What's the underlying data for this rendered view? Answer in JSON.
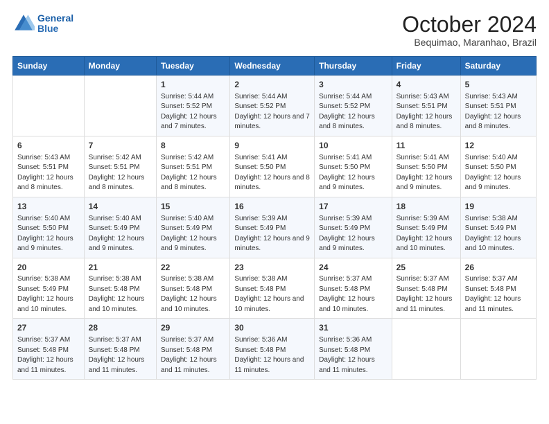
{
  "logo": {
    "line1": "General",
    "line2": "Blue"
  },
  "title": "October 2024",
  "subtitle": "Bequimao, Maranhao, Brazil",
  "weekdays": [
    "Sunday",
    "Monday",
    "Tuesday",
    "Wednesday",
    "Thursday",
    "Friday",
    "Saturday"
  ],
  "weeks": [
    [
      {
        "day": "",
        "info": ""
      },
      {
        "day": "",
        "info": ""
      },
      {
        "day": "1",
        "info": "Sunrise: 5:44 AM\nSunset: 5:52 PM\nDaylight: 12 hours and 7 minutes."
      },
      {
        "day": "2",
        "info": "Sunrise: 5:44 AM\nSunset: 5:52 PM\nDaylight: 12 hours and 7 minutes."
      },
      {
        "day": "3",
        "info": "Sunrise: 5:44 AM\nSunset: 5:52 PM\nDaylight: 12 hours and 8 minutes."
      },
      {
        "day": "4",
        "info": "Sunrise: 5:43 AM\nSunset: 5:51 PM\nDaylight: 12 hours and 8 minutes."
      },
      {
        "day": "5",
        "info": "Sunrise: 5:43 AM\nSunset: 5:51 PM\nDaylight: 12 hours and 8 minutes."
      }
    ],
    [
      {
        "day": "6",
        "info": "Sunrise: 5:43 AM\nSunset: 5:51 PM\nDaylight: 12 hours and 8 minutes."
      },
      {
        "day": "7",
        "info": "Sunrise: 5:42 AM\nSunset: 5:51 PM\nDaylight: 12 hours and 8 minutes."
      },
      {
        "day": "8",
        "info": "Sunrise: 5:42 AM\nSunset: 5:51 PM\nDaylight: 12 hours and 8 minutes."
      },
      {
        "day": "9",
        "info": "Sunrise: 5:41 AM\nSunset: 5:50 PM\nDaylight: 12 hours and 8 minutes."
      },
      {
        "day": "10",
        "info": "Sunrise: 5:41 AM\nSunset: 5:50 PM\nDaylight: 12 hours and 9 minutes."
      },
      {
        "day": "11",
        "info": "Sunrise: 5:41 AM\nSunset: 5:50 PM\nDaylight: 12 hours and 9 minutes."
      },
      {
        "day": "12",
        "info": "Sunrise: 5:40 AM\nSunset: 5:50 PM\nDaylight: 12 hours and 9 minutes."
      }
    ],
    [
      {
        "day": "13",
        "info": "Sunrise: 5:40 AM\nSunset: 5:50 PM\nDaylight: 12 hours and 9 minutes."
      },
      {
        "day": "14",
        "info": "Sunrise: 5:40 AM\nSunset: 5:49 PM\nDaylight: 12 hours and 9 minutes."
      },
      {
        "day": "15",
        "info": "Sunrise: 5:40 AM\nSunset: 5:49 PM\nDaylight: 12 hours and 9 minutes."
      },
      {
        "day": "16",
        "info": "Sunrise: 5:39 AM\nSunset: 5:49 PM\nDaylight: 12 hours and 9 minutes."
      },
      {
        "day": "17",
        "info": "Sunrise: 5:39 AM\nSunset: 5:49 PM\nDaylight: 12 hours and 9 minutes."
      },
      {
        "day": "18",
        "info": "Sunrise: 5:39 AM\nSunset: 5:49 PM\nDaylight: 12 hours and 10 minutes."
      },
      {
        "day": "19",
        "info": "Sunrise: 5:38 AM\nSunset: 5:49 PM\nDaylight: 12 hours and 10 minutes."
      }
    ],
    [
      {
        "day": "20",
        "info": "Sunrise: 5:38 AM\nSunset: 5:49 PM\nDaylight: 12 hours and 10 minutes."
      },
      {
        "day": "21",
        "info": "Sunrise: 5:38 AM\nSunset: 5:48 PM\nDaylight: 12 hours and 10 minutes."
      },
      {
        "day": "22",
        "info": "Sunrise: 5:38 AM\nSunset: 5:48 PM\nDaylight: 12 hours and 10 minutes."
      },
      {
        "day": "23",
        "info": "Sunrise: 5:38 AM\nSunset: 5:48 PM\nDaylight: 12 hours and 10 minutes."
      },
      {
        "day": "24",
        "info": "Sunrise: 5:37 AM\nSunset: 5:48 PM\nDaylight: 12 hours and 10 minutes."
      },
      {
        "day": "25",
        "info": "Sunrise: 5:37 AM\nSunset: 5:48 PM\nDaylight: 12 hours and 11 minutes."
      },
      {
        "day": "26",
        "info": "Sunrise: 5:37 AM\nSunset: 5:48 PM\nDaylight: 12 hours and 11 minutes."
      }
    ],
    [
      {
        "day": "27",
        "info": "Sunrise: 5:37 AM\nSunset: 5:48 PM\nDaylight: 12 hours and 11 minutes."
      },
      {
        "day": "28",
        "info": "Sunrise: 5:37 AM\nSunset: 5:48 PM\nDaylight: 12 hours and 11 minutes."
      },
      {
        "day": "29",
        "info": "Sunrise: 5:37 AM\nSunset: 5:48 PM\nDaylight: 12 hours and 11 minutes."
      },
      {
        "day": "30",
        "info": "Sunrise: 5:36 AM\nSunset: 5:48 PM\nDaylight: 12 hours and 11 minutes."
      },
      {
        "day": "31",
        "info": "Sunrise: 5:36 AM\nSunset: 5:48 PM\nDaylight: 12 hours and 11 minutes."
      },
      {
        "day": "",
        "info": ""
      },
      {
        "day": "",
        "info": ""
      }
    ]
  ]
}
